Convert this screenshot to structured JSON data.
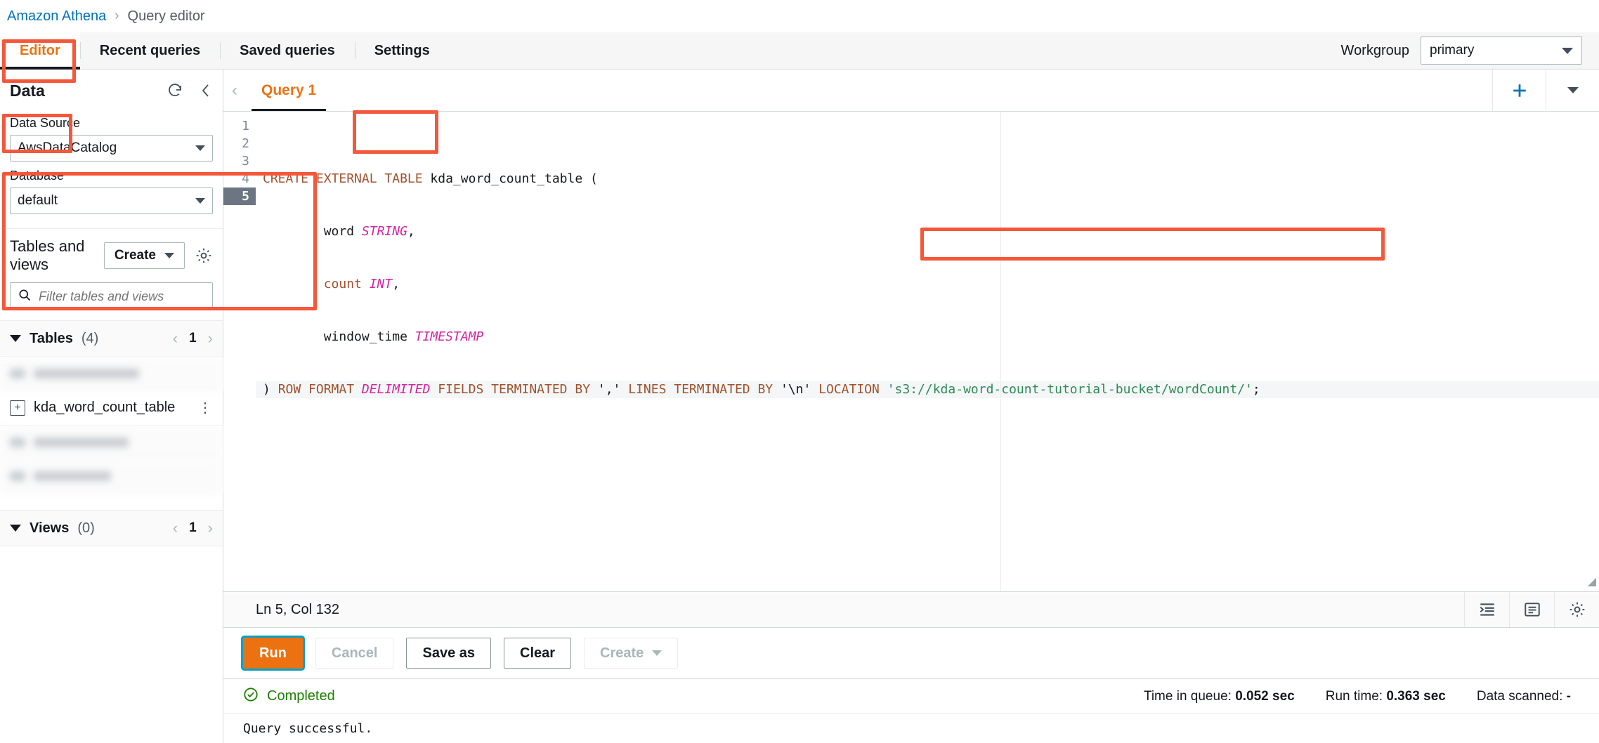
{
  "breadcrumb": {
    "root": "Amazon Athena",
    "separator": "›",
    "current": "Query editor"
  },
  "tabs": [
    {
      "label": "Editor",
      "active": true
    },
    {
      "label": "Recent queries",
      "active": false
    },
    {
      "label": "Saved queries",
      "active": false
    },
    {
      "label": "Settings",
      "active": false
    }
  ],
  "workgroup": {
    "label": "Workgroup",
    "value": "primary"
  },
  "sidebar": {
    "title": "Data",
    "refresh_icon": "refresh-icon",
    "collapse_icon": "chevron-left-icon",
    "data_source": {
      "label": "Data Source",
      "value": "AwsDataCatalog"
    },
    "database": {
      "label": "Database",
      "value": "default"
    },
    "tables_views": {
      "title": "Tables and views",
      "create_label": "Create",
      "settings_icon": "gear-icon",
      "filter_placeholder": "Filter tables and views",
      "filter_value": ""
    },
    "tables_group": {
      "name": "Tables",
      "count": "(4)",
      "page": "1"
    },
    "views_group": {
      "name": "Views",
      "count": "(0)",
      "page": "1"
    },
    "table_items": [
      {
        "label": "",
        "redacted": true
      },
      {
        "label": "kda_word_count_table",
        "redacted": false
      },
      {
        "label": "",
        "redacted": true
      },
      {
        "label": "",
        "redacted": true
      }
    ]
  },
  "query_tab": {
    "label": "Query 1",
    "prev_icon": "chevron-left-icon",
    "add_icon": "plus-icon",
    "more_icon": "chevron-down-icon"
  },
  "code": {
    "lines": [
      {
        "num": "1",
        "active": false,
        "tokens": [
          {
            "t": "CREATE EXTERNAL TABLE ",
            "c": "kw"
          },
          {
            "t": "kda_word_count_table (",
            "c": "plain"
          }
        ]
      },
      {
        "num": "2",
        "active": false,
        "tokens": [
          {
            "t": "        word ",
            "c": "plain"
          },
          {
            "t": "STRING",
            "c": "typ"
          },
          {
            "t": ",",
            "c": "plain"
          }
        ]
      },
      {
        "num": "3",
        "active": false,
        "tokens": [
          {
            "t": "        count ",
            "c": "kw"
          },
          {
            "t": "INT",
            "c": "typ"
          },
          {
            "t": ",",
            "c": "plain"
          }
        ]
      },
      {
        "num": "4",
        "active": false,
        "tokens": [
          {
            "t": "        window_time ",
            "c": "plain"
          },
          {
            "t": "TIMESTAMP",
            "c": "typ"
          }
        ]
      },
      {
        "num": "5",
        "active": true,
        "tokens": [
          {
            "t": ") ",
            "c": "plain"
          },
          {
            "t": "ROW FORMAT ",
            "c": "kw"
          },
          {
            "t": "DELIMITED",
            "c": "typ"
          },
          {
            "t": " FIELDS TERMINATED BY ",
            "c": "kw"
          },
          {
            "t": "','",
            "c": "plain"
          },
          {
            "t": " LINES TERMINATED BY ",
            "c": "kw"
          },
          {
            "t": "'\\n'",
            "c": "plain"
          },
          {
            "t": " LOCATION ",
            "c": "kw"
          },
          {
            "t": "'s3://kda-word-count-tutorial-bucket/wordCount/'",
            "c": "str"
          },
          {
            "t": ";",
            "c": "plain"
          }
        ]
      }
    ]
  },
  "status_strip": {
    "cursor": "Ln 5, Col 132",
    "icons": [
      "format-indent-icon",
      "word-wrap-icon",
      "gear-icon"
    ]
  },
  "actions": {
    "run": "Run",
    "cancel": "Cancel",
    "save_as": "Save as",
    "clear": "Clear",
    "create": "Create"
  },
  "result": {
    "status_icon": "check-circle-icon",
    "status": "Completed",
    "time_in_queue_label": "Time in queue:",
    "time_in_queue_value": "0.052 sec",
    "run_time_label": "Run time:",
    "run_time_value": "0.363 sec",
    "data_scanned_label": "Data scanned:",
    "data_scanned_value": "-",
    "message": "Query successful."
  },
  "colors": {
    "accent_orange": "#ec7211",
    "link_blue": "#0073bb",
    "annotation_red": "#f5573b",
    "success_green": "#1d8102",
    "focus_blue": "#00a1c9"
  }
}
